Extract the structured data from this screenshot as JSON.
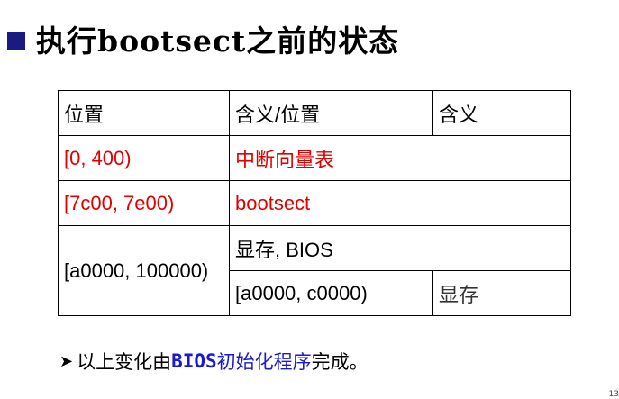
{
  "title": "执行bootsect之前的状态",
  "table": {
    "headers": [
      "位置",
      "含义/位置",
      "含义"
    ],
    "rows": [
      {
        "pos": "[0, 400)",
        "meaning": "中断向量表"
      },
      {
        "pos": "[7c00, 7e00)",
        "meaning": "bootsect"
      },
      {
        "pos": "[a0000, 100000)",
        "meaning": "显存, BIOS",
        "sub_pos": "[a0000, c0000)",
        "sub_meaning": "显存"
      }
    ]
  },
  "note": {
    "prefix": "以上变化由",
    "highlight_bios": "BIOS",
    "highlight_rest": "初始化程序",
    "suffix": "完成。"
  },
  "colors": {
    "bullet": "#1a1a80",
    "red_text": "#e00000",
    "highlight": "#1a1ad0"
  },
  "icons": {
    "title_bullet": "square-bullet-icon",
    "note_bullet": "arrow-bullet-icon"
  },
  "page_number": "13"
}
